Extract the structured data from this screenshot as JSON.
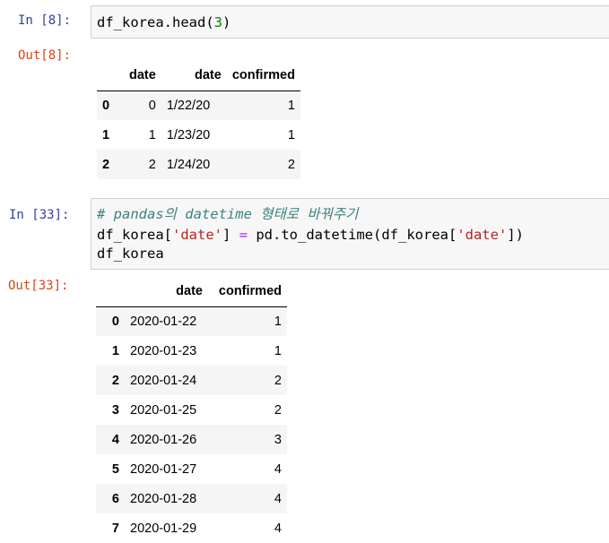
{
  "cells": [
    {
      "in_prompt": "In [8]:",
      "code": {
        "obj": "df_korea",
        "method": ".head(",
        "arg": "3",
        "close": ")"
      },
      "out_prompt": "Out[8]:",
      "table": {
        "columns": [
          "date",
          "date",
          "confirmed"
        ],
        "rows": [
          {
            "index": "0",
            "c1": "0",
            "c2": "1/22/20",
            "c3": "1"
          },
          {
            "index": "1",
            "c1": "1",
            "c2": "1/23/20",
            "c3": "1"
          },
          {
            "index": "2",
            "c1": "2",
            "c2": "1/24/20",
            "c3": "2"
          }
        ]
      }
    },
    {
      "in_prompt": "In [33]:",
      "code": {
        "comment": "# pandas의 datetime 형태로 바꿔주기",
        "l2_a": "df_korea[",
        "l2_str1": "'date'",
        "l2_b": "] ",
        "l2_op": "=",
        "l2_c": " pd.to_datetime(df_korea[",
        "l2_str2": "'date'",
        "l2_d": "])",
        "l3": "df_korea"
      },
      "out_prompt": "Out[33]:",
      "table": {
        "columns": [
          "date",
          "confirmed"
        ],
        "rows": [
          {
            "index": "0",
            "c1": "2020-01-22",
            "c2": "1"
          },
          {
            "index": "1",
            "c1": "2020-01-23",
            "c2": "1"
          },
          {
            "index": "2",
            "c1": "2020-01-24",
            "c2": "2"
          },
          {
            "index": "3",
            "c1": "2020-01-25",
            "c2": "2"
          },
          {
            "index": "4",
            "c1": "2020-01-26",
            "c2": "3"
          },
          {
            "index": "5",
            "c1": "2020-01-27",
            "c2": "4"
          },
          {
            "index": "6",
            "c1": "2020-01-28",
            "c2": "4"
          },
          {
            "index": "7",
            "c1": "2020-01-29",
            "c2": "4"
          }
        ]
      }
    }
  ],
  "colors": {
    "in_prompt": "#303f9f",
    "out_prompt": "#d84315",
    "code_bg": "#f7f7f7",
    "string": "#ba2121",
    "number": "#008000",
    "operator": "#aa22ff",
    "comment": "#408080"
  }
}
